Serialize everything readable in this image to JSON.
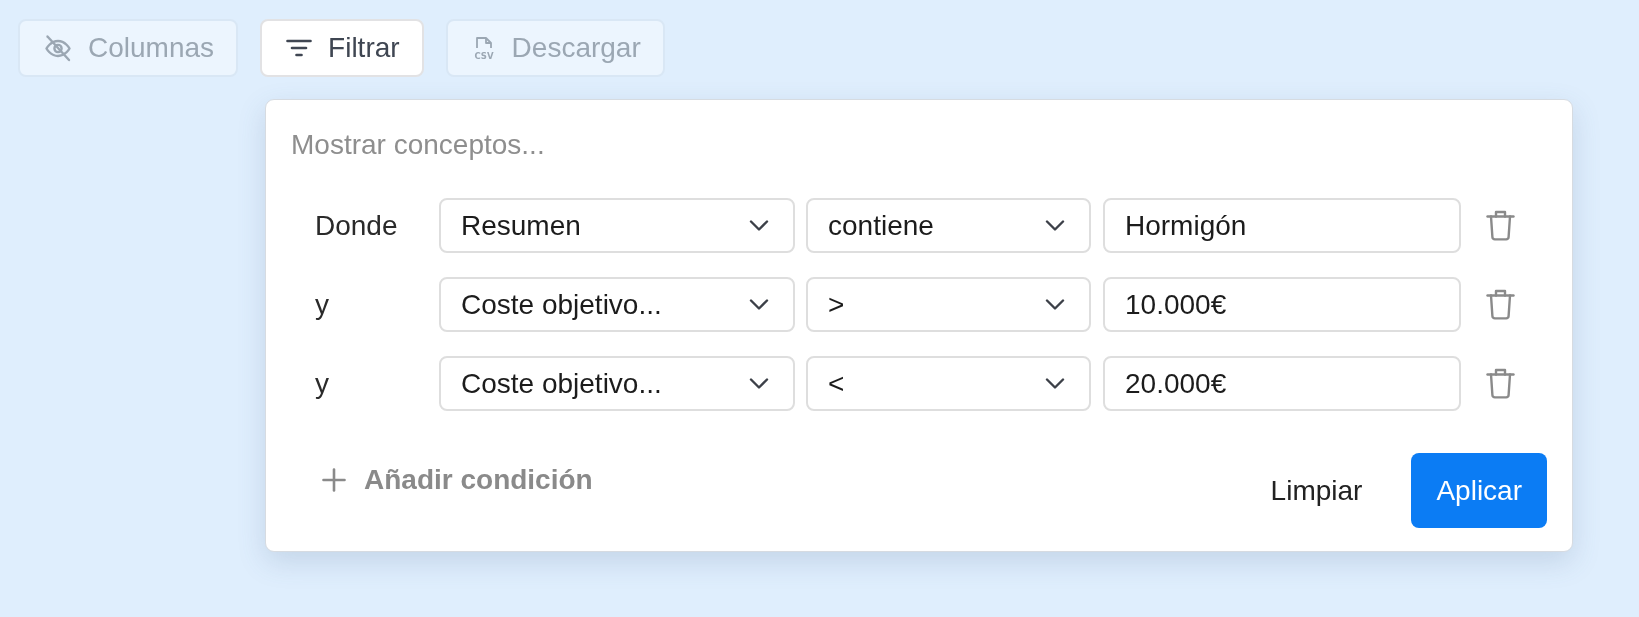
{
  "toolbar": {
    "buttons": [
      {
        "kind": "columns",
        "label": "Columnas",
        "selected": false
      },
      {
        "kind": "filter",
        "label": "Filtrar",
        "selected": true
      },
      {
        "kind": "download",
        "label": "Descargar",
        "icon_text": "CSV",
        "selected": false
      }
    ]
  },
  "filter_panel": {
    "search": {
      "placeholder": "Mostrar conceptos..."
    },
    "conditions": [
      {
        "connector": "Donde",
        "field": "Resumen",
        "operator": "contiene",
        "value": "Hormigón"
      },
      {
        "connector": "y",
        "field": "Coste objetivo...",
        "operator": ">",
        "value": "10.000€"
      },
      {
        "connector": "y",
        "field": "Coste objetivo...",
        "operator": "<",
        "value": "20.000€"
      }
    ],
    "add_button": "Añadir condición",
    "actions": [
      {
        "kind": "text",
        "label": "Limpiar"
      },
      {
        "kind": "primary",
        "label": "Aplicar"
      }
    ]
  }
}
